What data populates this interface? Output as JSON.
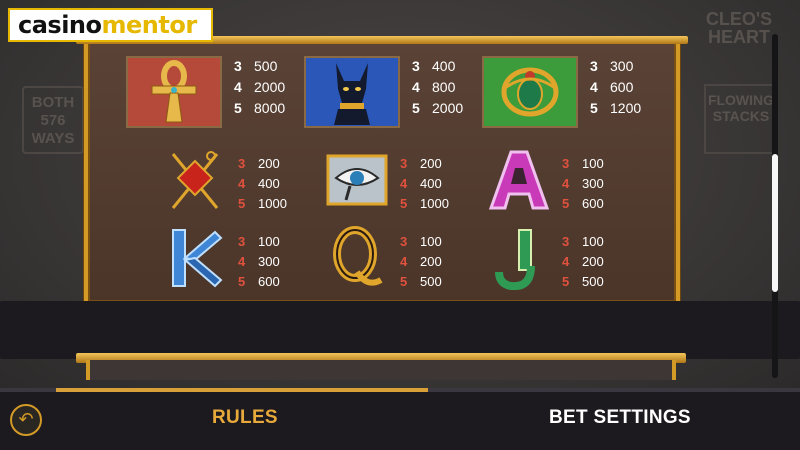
{
  "watermark": {
    "part1": "casino",
    "part2": "mentor"
  },
  "background": {
    "left_badge": "BOTH 576 WAYS",
    "logo": "CLEO'S HEART",
    "right_badge": "FLOWING STACKS"
  },
  "colors": {
    "accent": "#e8a93b",
    "frame": "#d39a26",
    "panel": "#5a4336",
    "pay_number": "#e0513e"
  },
  "paytable": {
    "row1": [
      {
        "icon": "ankh-icon",
        "bg": "red",
        "pays": [
          {
            "n": "3",
            "v": "500"
          },
          {
            "n": "4",
            "v": "2000"
          },
          {
            "n": "5",
            "v": "8000"
          }
        ]
      },
      {
        "icon": "bastet-cat-icon",
        "bg": "blue",
        "pays": [
          {
            "n": "3",
            "v": "400"
          },
          {
            "n": "4",
            "v": "800"
          },
          {
            "n": "5",
            "v": "2000"
          }
        ]
      },
      {
        "icon": "scarab-icon",
        "bg": "green",
        "pays": [
          {
            "n": "3",
            "v": "300"
          },
          {
            "n": "4",
            "v": "600"
          },
          {
            "n": "5",
            "v": "1200"
          }
        ]
      }
    ],
    "row2": [
      {
        "icon": "crook-flail-icon",
        "pays": [
          {
            "n": "3",
            "v": "200"
          },
          {
            "n": "4",
            "v": "400"
          },
          {
            "n": "5",
            "v": "1000"
          }
        ]
      },
      {
        "icon": "eye-of-horus-icon",
        "pays": [
          {
            "n": "3",
            "v": "200"
          },
          {
            "n": "4",
            "v": "400"
          },
          {
            "n": "5",
            "v": "1000"
          }
        ]
      },
      {
        "icon": "letter-a-icon",
        "letter": "A",
        "pays": [
          {
            "n": "3",
            "v": "100"
          },
          {
            "n": "4",
            "v": "300"
          },
          {
            "n": "5",
            "v": "600"
          }
        ]
      }
    ],
    "row3": [
      {
        "icon": "letter-k-icon",
        "letter": "K",
        "pays": [
          {
            "n": "3",
            "v": "100"
          },
          {
            "n": "4",
            "v": "300"
          },
          {
            "n": "5",
            "v": "600"
          }
        ]
      },
      {
        "icon": "letter-q-icon",
        "letter": "Q",
        "pays": [
          {
            "n": "3",
            "v": "100"
          },
          {
            "n": "4",
            "v": "200"
          },
          {
            "n": "5",
            "v": "500"
          }
        ]
      },
      {
        "icon": "letter-j-icon",
        "letter": "J",
        "pays": [
          {
            "n": "3",
            "v": "100"
          },
          {
            "n": "4",
            "v": "200"
          },
          {
            "n": "5",
            "v": "500"
          }
        ]
      }
    ]
  },
  "scroll": {
    "position": 0.35
  },
  "progress": {
    "fill": 0.47
  },
  "nav": {
    "back_icon": "back-arrow-icon",
    "rules_label": "RULES",
    "bet_label": "BET SETTINGS"
  }
}
